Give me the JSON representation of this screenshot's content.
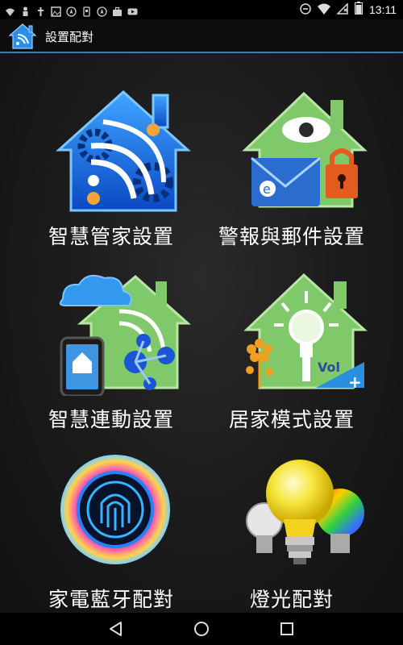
{
  "status_bar": {
    "time": "13:11",
    "left_icons": [
      "wifi-icon",
      "person-icon",
      "usb-icon",
      "image-icon",
      "compass-icon",
      "android-icon",
      "compass-icon",
      "briefcase-icon",
      "youtube-icon"
    ],
    "right_icons": [
      "minus-circle-icon",
      "wifi-signal-icon",
      "no-sim-icon",
      "battery-icon"
    ]
  },
  "action_bar": {
    "title": "設置配對",
    "app_icon": "smart-home-icon"
  },
  "tiles": [
    {
      "label": "智慧管家設置",
      "icon": "smart-house-wifi-icon"
    },
    {
      "label": "警報與郵件設置",
      "icon": "alarm-mail-lock-icon"
    },
    {
      "label": "智慧連動設置",
      "icon": "cloud-link-house-icon"
    },
    {
      "label": "居家模式設置",
      "icon": "home-mode-bulb-icon"
    },
    {
      "label": "家電藍牙配對",
      "icon": "bluetooth-fingerprint-icon"
    },
    {
      "label": "燈光配對",
      "icon": "light-bulbs-icon"
    }
  ],
  "nav_bar": {
    "buttons": [
      "back-icon",
      "home-icon",
      "recents-icon"
    ]
  },
  "colors": {
    "accent": "#3a7fb0",
    "background": "#1a1a1a",
    "house_green": "#7fc96b",
    "house_blue": "#1e6fe0",
    "bulb_yellow": "#f7e53b"
  }
}
